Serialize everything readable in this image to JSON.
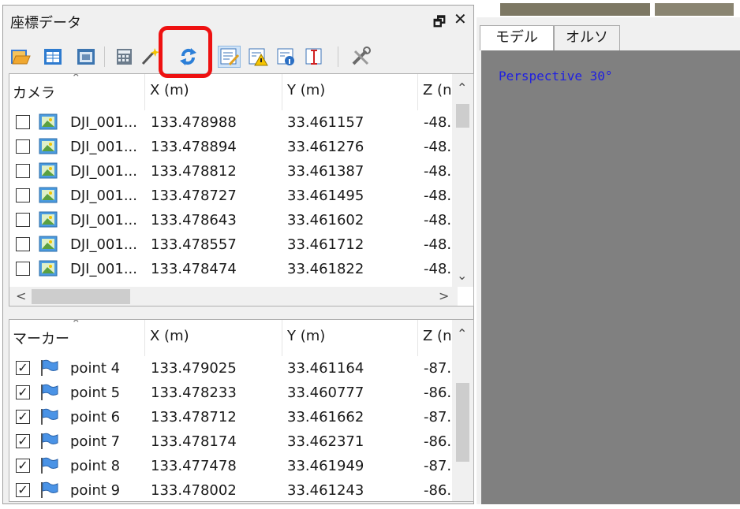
{
  "panel": {
    "title": "座標データ",
    "float_glyph": "🗗",
    "close_glyph": "✕"
  },
  "toolbar": {
    "icons": [
      "folder-open-icon",
      "import-table-icon",
      "import-images-icon",
      "calculator-icon",
      "magic-wand-icon",
      "refresh-icon",
      "edit-list-icon",
      "warning-list-icon",
      "info-list-icon",
      "error-bars-icon",
      "settings-tools-icon"
    ],
    "highlighted": "refresh-icon",
    "highlight_color": "#ee1111"
  },
  "camera_table": {
    "headers": [
      "カメラ",
      "X (m)",
      "Y (m)",
      "Z (n"
    ],
    "rows": [
      {
        "checked": false,
        "name": "DJI_001...",
        "x": "133.478988",
        "y": "33.461157",
        "z": "-48.:"
      },
      {
        "checked": false,
        "name": "DJI_001...",
        "x": "133.478894",
        "y": "33.461276",
        "z": "-48.:"
      },
      {
        "checked": false,
        "name": "DJI_001...",
        "x": "133.478812",
        "y": "33.461387",
        "z": "-48.."
      },
      {
        "checked": false,
        "name": "DJI_001...",
        "x": "133.478727",
        "y": "33.461495",
        "z": "-48.."
      },
      {
        "checked": false,
        "name": "DJI_001...",
        "x": "133.478643",
        "y": "33.461602",
        "z": "-48.."
      },
      {
        "checked": false,
        "name": "DJI_001...",
        "x": "133.478557",
        "y": "33.461712",
        "z": "-48.("
      },
      {
        "checked": false,
        "name": "DJI_001...",
        "x": "133.478474",
        "y": "33.461822",
        "z": "-48.("
      }
    ]
  },
  "marker_table": {
    "headers": [
      "マーカー",
      "X (m)",
      "Y (m)",
      "Z (n"
    ],
    "rows": [
      {
        "checked": true,
        "name": "point 4",
        "x": "133.479025",
        "y": "33.461164",
        "z": "-87.("
      },
      {
        "checked": true,
        "name": "point 5",
        "x": "133.478233",
        "y": "33.460777",
        "z": "-86."
      },
      {
        "checked": true,
        "name": "point 6",
        "x": "133.478712",
        "y": "33.461662",
        "z": "-87.("
      },
      {
        "checked": true,
        "name": "point 7",
        "x": "133.478174",
        "y": "33.462371",
        "z": "-86."
      },
      {
        "checked": true,
        "name": "point 8",
        "x": "133.477478",
        "y": "33.461949",
        "z": "-87.."
      },
      {
        "checked": true,
        "name": "point 9",
        "x": "133.478002",
        "y": "33.461243",
        "z": "-86.."
      }
    ]
  },
  "right": {
    "tabs": [
      "モデル",
      "オルソ"
    ],
    "active_tab": "モデル",
    "viewport_label": "Perspective 30°",
    "viewport_bg": "#808080"
  },
  "glyphs": {
    "up": "⌃",
    "down": "⌄",
    "left": "<",
    "right": ">",
    "check": "✓"
  }
}
